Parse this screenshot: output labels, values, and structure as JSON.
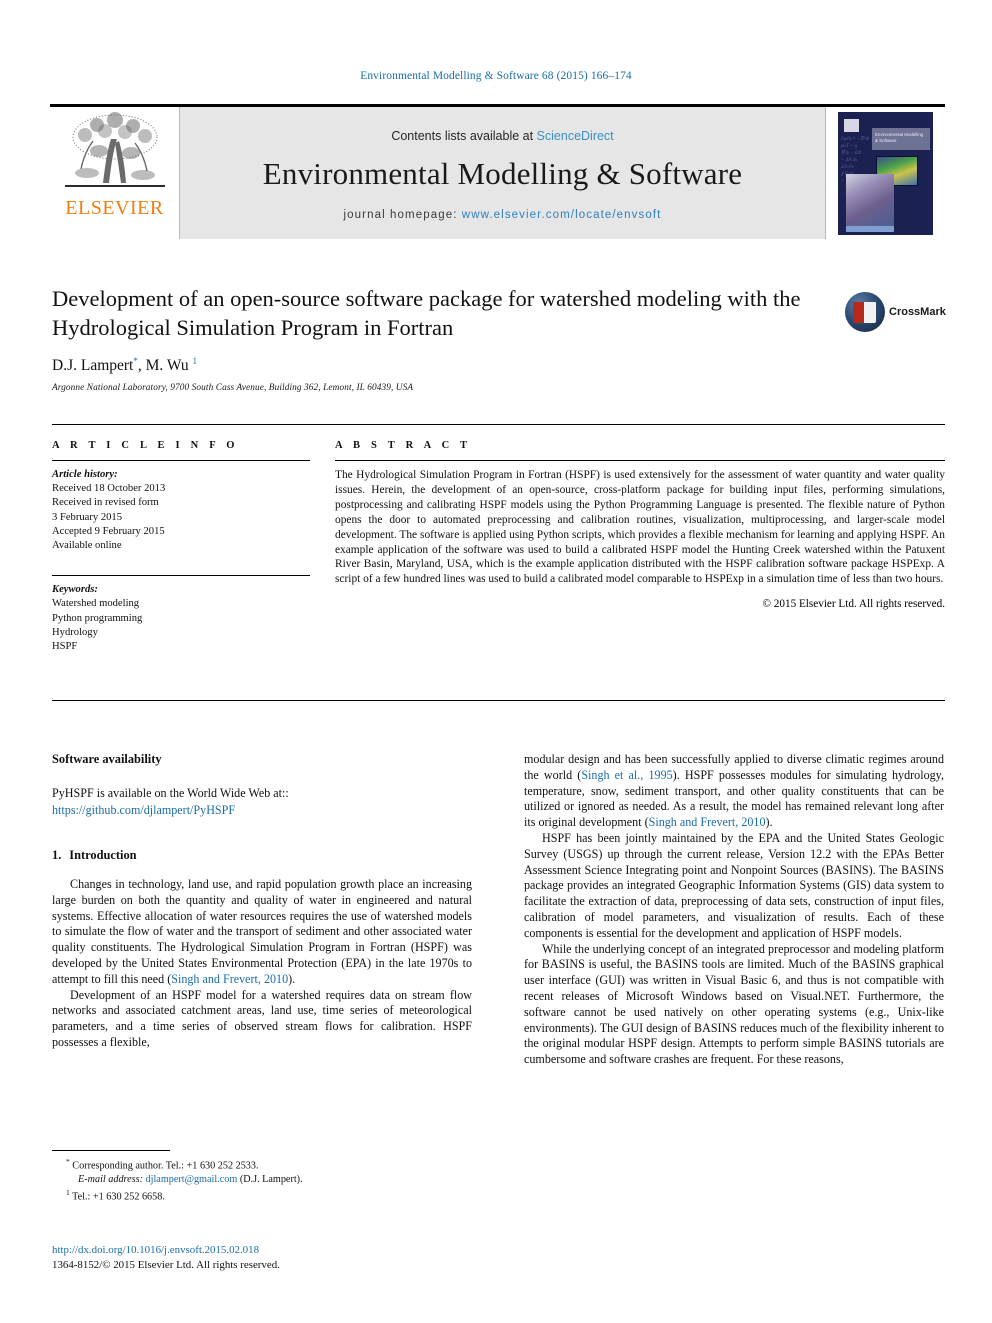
{
  "running_head": "Environmental Modelling & Software 68 (2015) 166–174",
  "masthead": {
    "publisher_wordmark": "ELSEVIER",
    "contents_prefix": "Contents lists available at ",
    "contents_link": "ScienceDirect",
    "journal_name": "Environmental Modelling & Software",
    "homepage_label": "journal homepage:",
    "homepage_url": "www.elsevier.com/locate/envsoft",
    "cover_title": "Environmental Modelling & Software"
  },
  "title": "Development of an open-source software package for watershed modeling with the Hydrological Simulation Program in Fortran",
  "authors": {
    "author1": "D.J. Lampert",
    "author1_mark": "*",
    "separator": ", ",
    "author2": "M. Wu",
    "author2_mark": "1"
  },
  "affiliation": "Argonne National Laboratory, 9700 South Cass Avenue, Building 362, Lemont, IL 60439, USA",
  "crossmark": {
    "label": "CrossMark"
  },
  "article_info": {
    "heading": "A R T I C L E   I N F O",
    "history_label": "Article history:",
    "history": [
      "Received 18 October 2013",
      "Received in revised form",
      "3 February 2015",
      "Accepted 9 February 2015",
      "Available online"
    ],
    "keywords_label": "Keywords:",
    "keywords": [
      "Watershed modeling",
      "Python programming",
      "Hydrology",
      "HSPF"
    ]
  },
  "abstract": {
    "heading": "A B S T R A C T",
    "text": "The Hydrological Simulation Program in Fortran (HSPF) is used extensively for the assessment of water quantity and water quality issues. Herein, the development of an open-source, cross-platform package for building input files, performing simulations, postprocessing and calibrating HSPF models using the Python Programming Language is presented. The flexible nature of Python opens the door to automated preprocessing and calibration routines, visualization, multiprocessing, and larger-scale model development. The software is applied using Python scripts, which provides a flexible mechanism for learning and applying HSPF. An example application of the software was used to build a calibrated HSPF model the Hunting Creek watershed within the Patuxent River Basin, Maryland, USA, which is the example application distributed with the HSPF calibration software package HSPExp. A script of a few hundred lines was used to build a calibrated model comparable to HSPExp in a simulation time of less than two hours.",
    "copyright": "© 2015 Elsevier Ltd. All rights reserved."
  },
  "software_availability": {
    "heading": "Software availability",
    "text_prefix": "PyHSPF is available on the World Wide Web at:: ",
    "link": "https://github.com/djlampert/PyHSPF"
  },
  "introduction": {
    "number": "1.",
    "heading": "Introduction",
    "paragraph1_a": "Changes in technology, land use, and rapid population growth place an increasing large burden on both the quantity and quality of water in engineered and natural systems. Effective allocation of water resources requires the use of watershed models to simulate the flow of water and the transport of sediment and other associated water quality constituents. The Hydrological Simulation Program in Fortran (HSPF) was developed by the United States Environmental Protection (EPA) in the late 1970s to attempt to fill this need (",
    "paragraph1_cite": "Singh and Frevert, 2010",
    "paragraph1_b": ").",
    "paragraph2": "Development of an HSPF model for a watershed requires data on stream flow networks and associated catchment areas, land use, time series of meteorological parameters, and a time series of observed stream flows for calibration. HSPF possesses a flexible,"
  },
  "right_column": {
    "p1_a": "modular design and has been successfully applied to diverse climatic regimes around the world (",
    "p1_cite1": "Singh et al., 1995",
    "p1_b": "). HSPF possesses modules for simulating hydrology, temperature, snow, sediment transport, and other quality constituents that can be utilized or ignored as needed. As a result, the model has remained relevant long after its original development (",
    "p1_cite2": "Singh and Frevert, 2010",
    "p1_c": ").",
    "p2": "HSPF has been jointly maintained by the EPA and the United States Geologic Survey (USGS) up through the current release, Version 12.2 with the EPAs Better Assessment Science Integrating point and Nonpoint Sources (BASINS). The BASINS package provides an integrated Geographic Information Systems (GIS) data system to facilitate the extraction of data, preprocessing of data sets, construction of input files, calibration of model parameters, and visualization of results. Each of these components is essential for the development and application of HSPF models.",
    "p3": "While the underlying concept of an integrated preprocessor and modeling platform for BASINS is useful, the BASINS tools are limited. Much of the BASINS graphical user interface (GUI) was written in Visual Basic 6, and thus is not compatible with recent releases of Microsoft Windows based on Visual.NET. Furthermore, the software cannot be used natively on other operating systems (e.g., Unix-like environments). The GUI design of BASINS reduces much of the flexibility inherent to the original modular HSPF design. Attempts to perform simple BASINS tutorials are cumbersome and software crashes are frequent. For these reasons,"
  },
  "footnotes": {
    "corresponding_mark": "*",
    "corresponding": "Corresponding author. Tel.: +1 630 252 2533.",
    "email_label": "E-mail address:",
    "email": "djlampert@gmail.com",
    "email_suffix": "(D.J. Lampert).",
    "note1_mark": "1",
    "note1": "Tel.: +1 630 252 6658."
  },
  "footer": {
    "doi": "http://dx.doi.org/10.1016/j.envsoft.2015.02.018",
    "issn_line": "1364-8152/© 2015 Elsevier Ltd. All rights reserved."
  },
  "colors": {
    "link": "#1b6ca8",
    "elsevier_orange": "#f07f13",
    "masthead_bg": "#e6e6e6",
    "cover_navy": "#1b2150"
  }
}
